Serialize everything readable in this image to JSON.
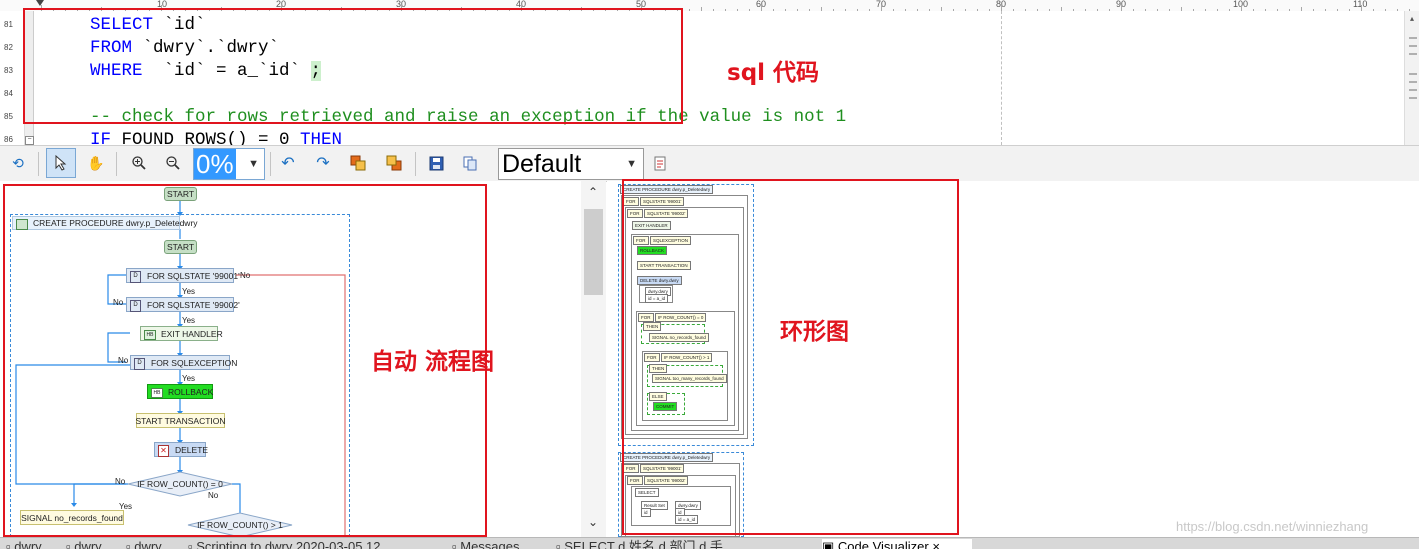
{
  "ruler": {
    "marks": [
      "10",
      "20",
      "30",
      "40",
      "50",
      "60",
      "70",
      "80",
      "90",
      "100",
      "110"
    ]
  },
  "editor": {
    "line_numbers": [
      "81",
      "82",
      "83",
      "84",
      "85",
      "86"
    ],
    "lines": [
      {
        "kw": "SELECT",
        "rest": " `id`"
      },
      {
        "kw": "FROM",
        "rest": " `dwry`.`dwry`"
      },
      {
        "kw": "WHERE",
        "rest": "  `id` = a_`id` ",
        "semi": ";"
      },
      {
        "kw": "",
        "rest": ""
      },
      {
        "comment": "-- check for rows retrieved and raise an exception if the value is not 1"
      },
      {
        "kw": "IF",
        "rest": " FOUND_ROWS() = 0 ",
        "kw2": "THEN"
      }
    ]
  },
  "toolbar": {
    "zoom": "0%",
    "style": "Default",
    "icons": [
      "refresh-icon",
      "pointer-icon",
      "hand-icon",
      "zoom-in-icon",
      "zoom-out-icon",
      "undo-icon",
      "redo-icon",
      "bring-front-icon",
      "send-back-icon",
      "save-icon",
      "copy-icon",
      "export-icon"
    ]
  },
  "flow": {
    "start_top": "START",
    "procedure": "CREATE PROCEDURE dwry.p_Deletedwry",
    "start_inner": "START",
    "sqlstate1": "FOR SQLSTATE '99001'",
    "sqlstate2": "FOR SQLSTATE '99002'",
    "exit_handler": "EXIT HANDLER",
    "sqlexception": "FOR SQLEXCEPTION",
    "rollback": "ROLLBACK",
    "start_tx": "START TRANSACTION",
    "delete": "DELETE",
    "if1": "IF ROW_COUNT() = 0",
    "signal": "SIGNAL no_records_found",
    "if2": "IF ROW_COUNT() > 1",
    "yes": "Yes",
    "no": "No"
  },
  "mini": {
    "procedure": "CREATE PROCEDURE dwry.p_Deletedwry",
    "for1": "FOR",
    "sqlstate1": "SQLSTATE '99001'",
    "for2": "FOR",
    "sqlstate2": "SQLSTATE '99002'",
    "exit_handler": "EXIT HANDLER",
    "for3": "FOR",
    "sqlexception": "SQLEXCEPTION",
    "rollback": "ROLLBACK",
    "start_tx": "START TRANSACTION",
    "delete": "DELETE dwry.dwry",
    "delete_sub1": "dwry.dwry",
    "delete_sub2": "id = a_id",
    "if1": "IF ROW_COUNT() = 0",
    "then1": "THEN",
    "signal1": "SIGNAL no_records_found",
    "if2": "IF ROW_COUNT() > 1",
    "then2": "THEN",
    "signal2": "SIGNAL too_many_records_found",
    "else": "ELSE",
    "commit": "COMMIT",
    "procedure2": "CREATE PROCEDURE dwry.p_Deletedwry",
    "for4": "FOR",
    "sqlstate3": "SQLSTATE '99001'",
    "for5": "FOR",
    "sqlstate4": "SQLSTATE '99002'",
    "select": "SELECT",
    "res1": "Result Set",
    "res2": "id",
    "res3": "dwry.dwry",
    "res4": "id",
    "res5": "id = a_id"
  },
  "annotations": {
    "sql": "sql 代码",
    "flow": "自动 流程图",
    "ring": "环形图"
  },
  "tabs": [
    "dwry",
    "dwry",
    "dwry",
    "Scripting to dwry 2020-03-05 12...",
    "Messages",
    "SELECT d.姓名,d.部门,d.手...",
    "Code Visualizer"
  ],
  "watermark": "https://blog.csdn.net/winniezhang",
  "colors": {
    "annotation_red": "#e0141e",
    "keyword_blue": "#0000ff",
    "comment_green": "#1f8f1f",
    "zoom_highlight": "#3399ff",
    "rollback_green": "#22dd22"
  }
}
